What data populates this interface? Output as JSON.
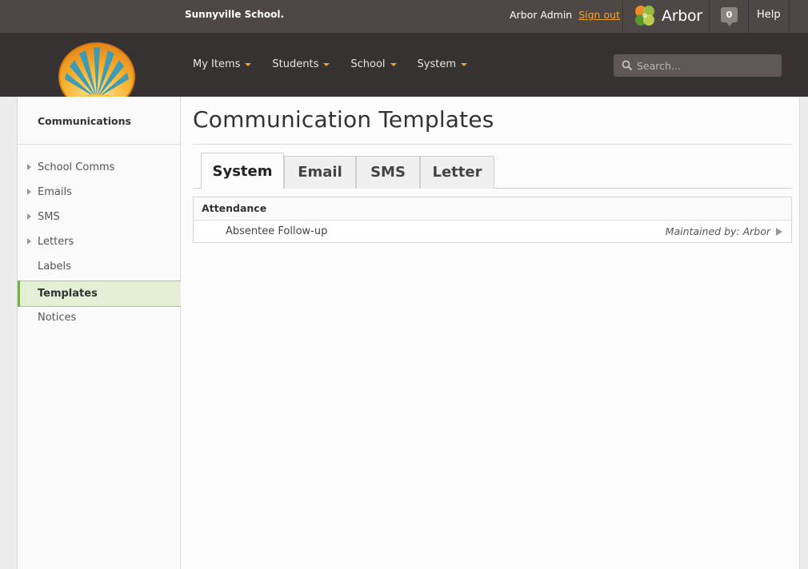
{
  "topbar": {
    "school_name": "Sunnyville School.",
    "user_name": "Arbor Admin",
    "sign_out": "Sign out",
    "brand": "Arbor",
    "notifications_count": "0",
    "help": "Help"
  },
  "nav": {
    "items": [
      "My Items",
      "Students",
      "School",
      "System"
    ]
  },
  "search": {
    "placeholder": "Search..."
  },
  "sidebar": {
    "title": "Communications",
    "items": [
      {
        "label": "School Comms",
        "expandable": true
      },
      {
        "label": "Emails",
        "expandable": true
      },
      {
        "label": "SMS",
        "expandable": true
      },
      {
        "label": "Letters",
        "expandable": true
      },
      {
        "label": "Labels",
        "expandable": false
      },
      {
        "label": "Templates",
        "expandable": false,
        "active": true
      },
      {
        "label": "Notices",
        "expandable": false
      }
    ]
  },
  "main": {
    "title": "Communication Templates",
    "tabs": [
      {
        "label": "System",
        "active": true
      },
      {
        "label": "Email"
      },
      {
        "label": "SMS"
      },
      {
        "label": "Letter"
      }
    ],
    "section": {
      "header": "Attendance",
      "rows": [
        {
          "name": "Absentee Follow-up",
          "maintained_by": "Maintained by: Arbor"
        }
      ]
    }
  },
  "colors": {
    "topbar": "#4d4845",
    "navbar": "#363231",
    "accent_orange": "#f0a23a",
    "active_green": "#e4efd6"
  }
}
